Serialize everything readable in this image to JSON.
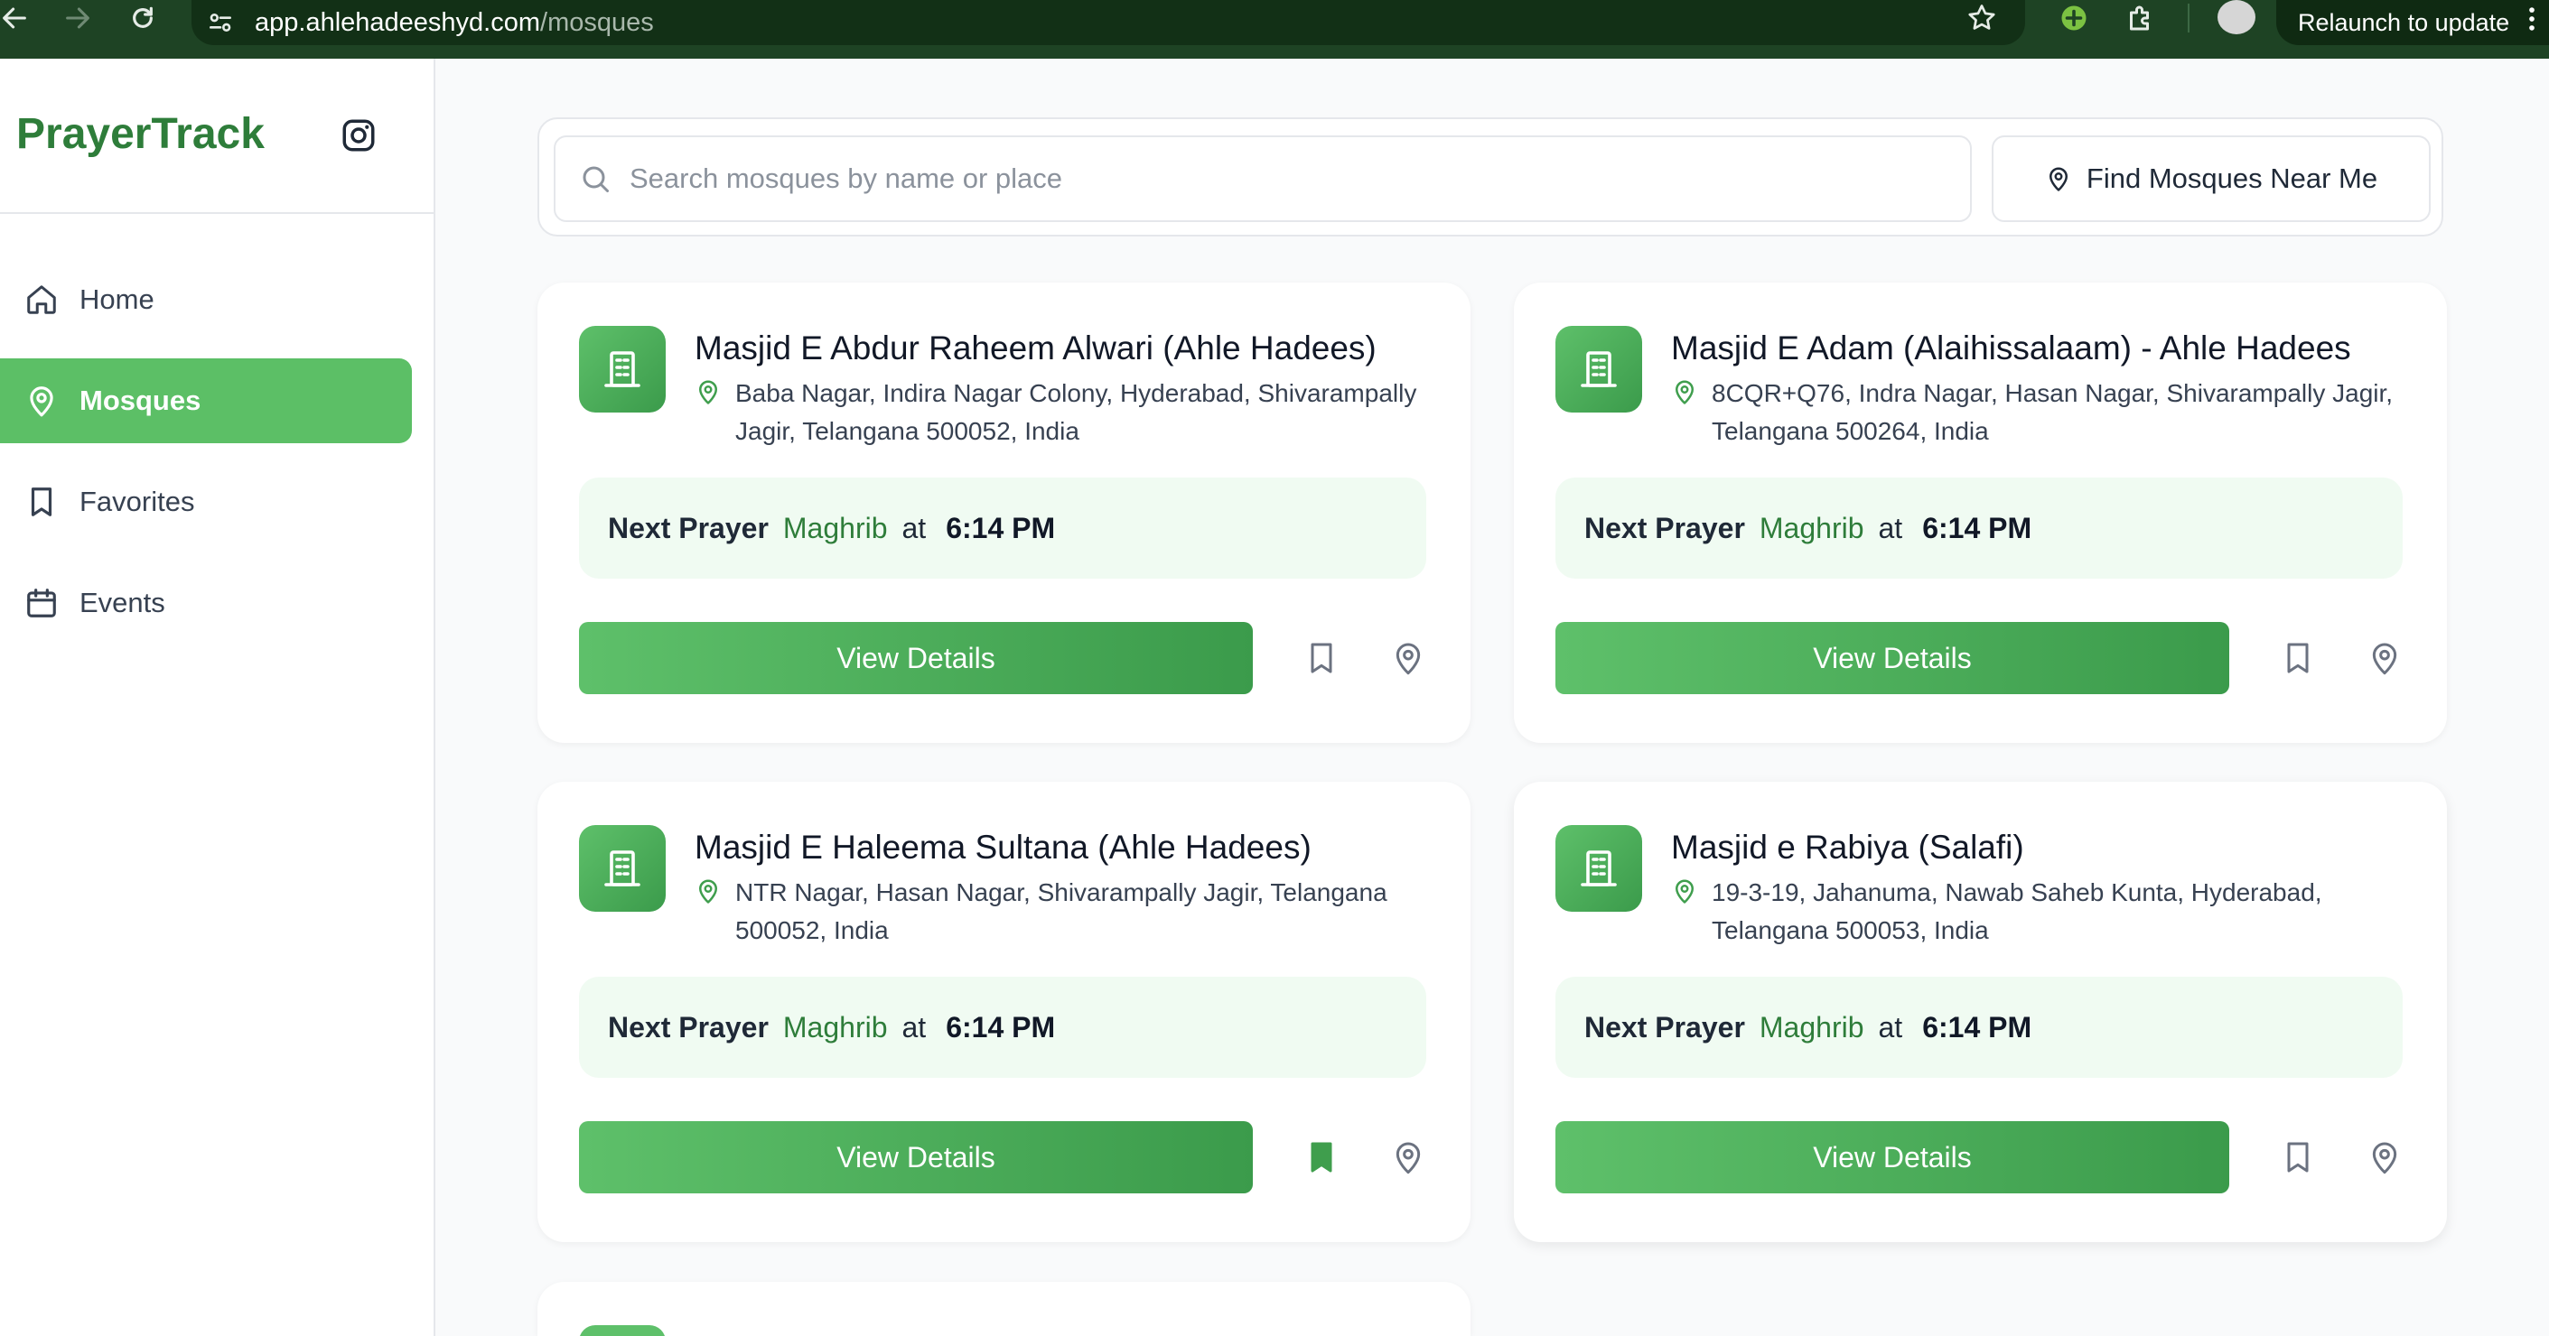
{
  "browser": {
    "url_host": "app.ahlehadeeshyd.com",
    "url_path": "/mosques",
    "relaunch_label": "Relaunch to update"
  },
  "sidebar": {
    "brand": "PrayerTrack",
    "items": [
      {
        "label": "Home",
        "icon": "home-icon",
        "active": false
      },
      {
        "label": "Mosques",
        "icon": "map-pin-icon",
        "active": true
      },
      {
        "label": "Favorites",
        "icon": "bookmark-icon",
        "active": false
      },
      {
        "label": "Events",
        "icon": "calendar-icon",
        "active": false
      }
    ]
  },
  "search": {
    "placeholder": "Search mosques by name or place",
    "value": "",
    "near_me_label": "Find Mosques Near Me"
  },
  "mosques": [
    {
      "name": "Masjid E Abdur Raheem Alwari (Ahle Hadees)",
      "address": "Baba Nagar, Indira Nagar Colony, Hyderabad, Shivarampally Jagir, Telangana 500052, India",
      "next_prayer_label": "Next Prayer",
      "prayer_name": "Maghrib",
      "at_label": "at",
      "prayer_time": "6:14 PM",
      "view_label": "View Details",
      "favorited": false
    },
    {
      "name": "Masjid E Adam (Alaihissalaam) - Ahle Hadees",
      "address": "8CQR+Q76, Indra Nagar, Hasan Nagar, Shivarampally Jagir, Telangana 500264, India",
      "next_prayer_label": "Next Prayer",
      "prayer_name": "Maghrib",
      "at_label": "at",
      "prayer_time": "6:14 PM",
      "view_label": "View Details",
      "favorited": false
    },
    {
      "name": "Masjid E Haleema Sultana (Ahle Hadees)",
      "address": "NTR Nagar, Hasan Nagar, Shivarampally Jagir, Telangana 500052, India",
      "next_prayer_label": "Next Prayer",
      "prayer_name": "Maghrib",
      "at_label": "at",
      "prayer_time": "6:14 PM",
      "view_label": "View Details",
      "favorited": true
    },
    {
      "name": "Masjid e Rabiya (Salafi)",
      "address": "19-3-19, Jahanuma, Nawab Saheb Kunta, Hyderabad, Telangana 500053, India",
      "next_prayer_label": "Next Prayer",
      "prayer_name": "Maghrib",
      "at_label": "at",
      "prayer_time": "6:14 PM",
      "view_label": "View Details",
      "favorited": false
    }
  ],
  "colors": {
    "brand_green": "#2e7d3a",
    "accent_green": "#5cbf66",
    "prayer_bg": "#f0fbf2",
    "chrome_bg": "#1e4324"
  }
}
